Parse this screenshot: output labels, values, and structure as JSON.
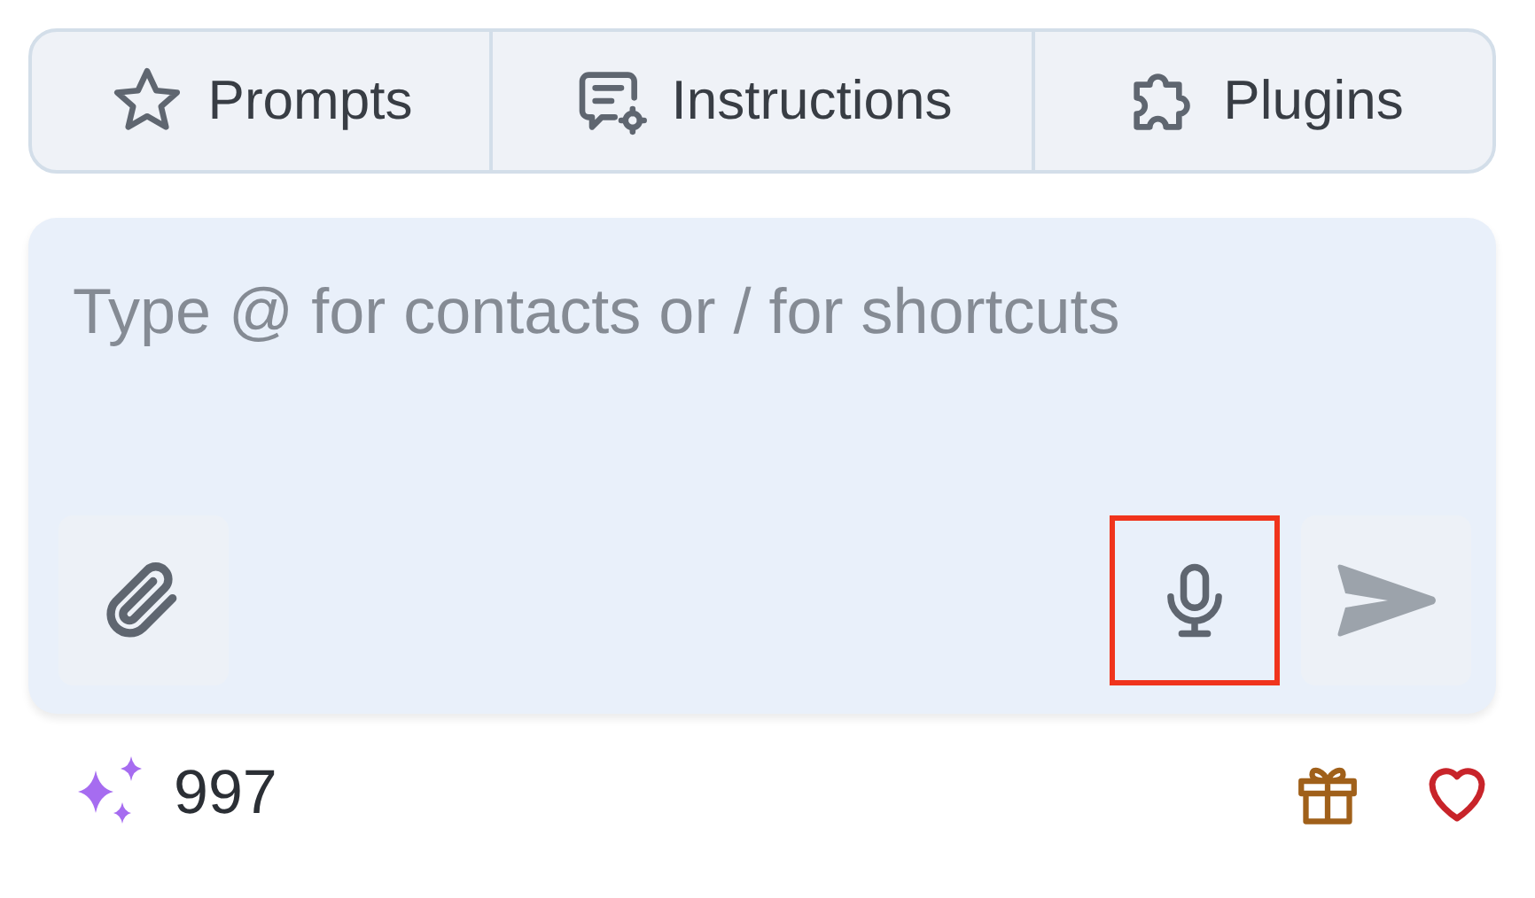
{
  "tabs": [
    {
      "kind": "star",
      "label": "Prompts"
    },
    {
      "kind": "instructions",
      "label": "Instructions"
    },
    {
      "kind": "plugin",
      "label": "Plugins"
    }
  ],
  "composer": {
    "placeholder": "Type @ for contacts or / for shortcuts",
    "mic": {
      "highlighted": true
    },
    "send": {
      "disabled": true
    }
  },
  "footer": {
    "credits": "997"
  }
}
